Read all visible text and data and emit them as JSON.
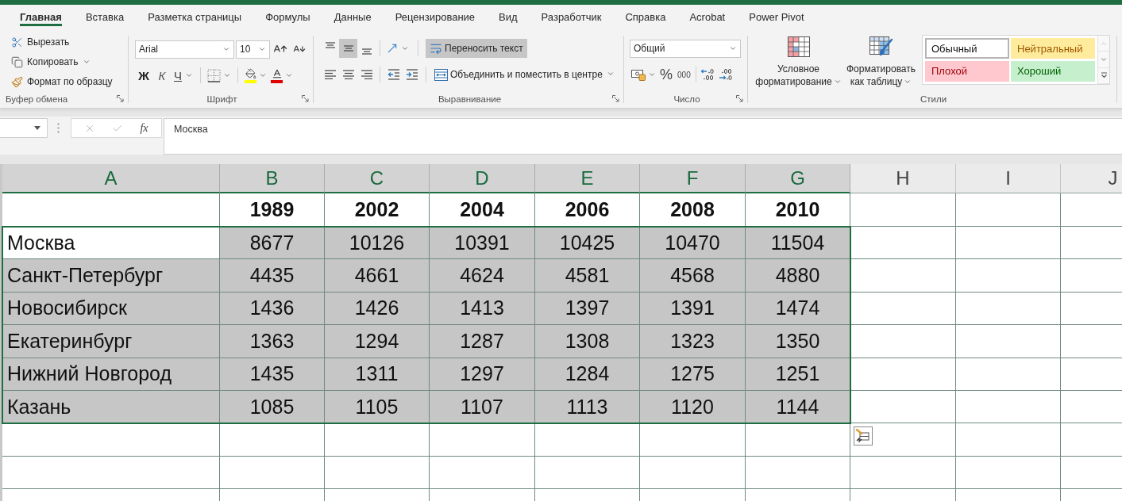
{
  "tabs": [
    {
      "label": "Главная",
      "selected": true
    },
    {
      "label": "Вставка",
      "selected": false
    },
    {
      "label": "Разметка страницы",
      "selected": false
    },
    {
      "label": "Формулы",
      "selected": false
    },
    {
      "label": "Данные",
      "selected": false
    },
    {
      "label": "Рецензирование",
      "selected": false
    },
    {
      "label": "Вид",
      "selected": false
    },
    {
      "label": "Разработчик",
      "selected": false
    },
    {
      "label": "Справка",
      "selected": false
    },
    {
      "label": "Acrobat",
      "selected": false
    },
    {
      "label": "Power Pivot",
      "selected": false
    }
  ],
  "ribbon": {
    "clipboard": {
      "label": "Буфер обмена",
      "commands": [
        {
          "kind": "cut",
          "label": "Вырезать",
          "dropdown": false
        },
        {
          "kind": "copy",
          "label": "Копировать",
          "dropdown": true
        },
        {
          "kind": "format-painter",
          "label": "Формат по образцу",
          "dropdown": false
        }
      ]
    },
    "font": {
      "label": "Шрифт",
      "font_name": "Arial",
      "font_size": "10",
      "styles": [
        {
          "kind": "bold",
          "label": "Ж"
        },
        {
          "kind": "italic",
          "label": "К"
        },
        {
          "kind": "underline",
          "label": "Ч"
        }
      ]
    },
    "alignment": {
      "label": "Выравнивание",
      "vertical": [
        {
          "kind": "top",
          "selected": false
        },
        {
          "kind": "middle",
          "selected": true
        },
        {
          "kind": "bottom",
          "selected": false
        }
      ],
      "horizontal": [
        {
          "kind": "left",
          "selected": false
        },
        {
          "kind": "center",
          "selected": false
        },
        {
          "kind": "right",
          "selected": false
        }
      ],
      "wrap_text": {
        "label": "Переносить текст",
        "selected": true
      },
      "merge": {
        "label": "Объединить и поместить в центре"
      }
    },
    "number": {
      "label": "Число",
      "format": "Общий",
      "percent": "%",
      "thousands": "000"
    },
    "styles": {
      "label": "Стили",
      "commands": [
        {
          "kind": "conditional-formatting",
          "label": "Условное форматирование"
        },
        {
          "kind": "format-as-table",
          "label": "Форматировать как таблицу"
        }
      ],
      "gallery": [
        {
          "kind": "normal",
          "label": "Обычный",
          "selected": true
        },
        {
          "kind": "neutral",
          "label": "Нейтральный",
          "selected": false
        },
        {
          "kind": "bad",
          "label": "Плохой",
          "selected": false
        },
        {
          "kind": "good",
          "label": "Хороший",
          "selected": false
        }
      ]
    }
  },
  "formula_bar": {
    "function_label": "fx",
    "value": "Москва"
  },
  "sheet": {
    "columns": [
      {
        "label": "A",
        "selected": true
      },
      {
        "label": "B",
        "selected": true
      },
      {
        "label": "C",
        "selected": true
      },
      {
        "label": "D",
        "selected": true
      },
      {
        "label": "E",
        "selected": true
      },
      {
        "label": "F",
        "selected": true
      },
      {
        "label": "G",
        "selected": true
      },
      {
        "label": "H",
        "selected": false
      },
      {
        "label": "I",
        "selected": false
      },
      {
        "label": "J",
        "selected": false
      }
    ],
    "header_row": [
      "1989",
      "2002",
      "2004",
      "2006",
      "2008",
      "2010"
    ],
    "rows": [
      {
        "city": "Москва",
        "values": [
          "8677",
          "10126",
          "10391",
          "10425",
          "10470",
          "11504"
        ],
        "selected": true,
        "active": true
      },
      {
        "city": "Санкт-Петербург",
        "values": [
          "4435",
          "4661",
          "4624",
          "4581",
          "4568",
          "4880"
        ],
        "selected": true,
        "active": false
      },
      {
        "city": "Новосибирск",
        "values": [
          "1436",
          "1426",
          "1413",
          "1397",
          "1391",
          "1474"
        ],
        "selected": true,
        "active": false
      },
      {
        "city": "Екатеринбург",
        "values": [
          "1363",
          "1294",
          "1287",
          "1308",
          "1323",
          "1350"
        ],
        "selected": true,
        "active": false
      },
      {
        "city": "Нижний Новгород",
        "values": [
          "1435",
          "1311",
          "1297",
          "1284",
          "1275",
          "1251"
        ],
        "selected": true,
        "active": false
      },
      {
        "city": "Казань",
        "values": [
          "1085",
          "1105",
          "1107",
          "1113",
          "1120",
          "1144"
        ],
        "selected": true,
        "active": false
      }
    ]
  }
}
